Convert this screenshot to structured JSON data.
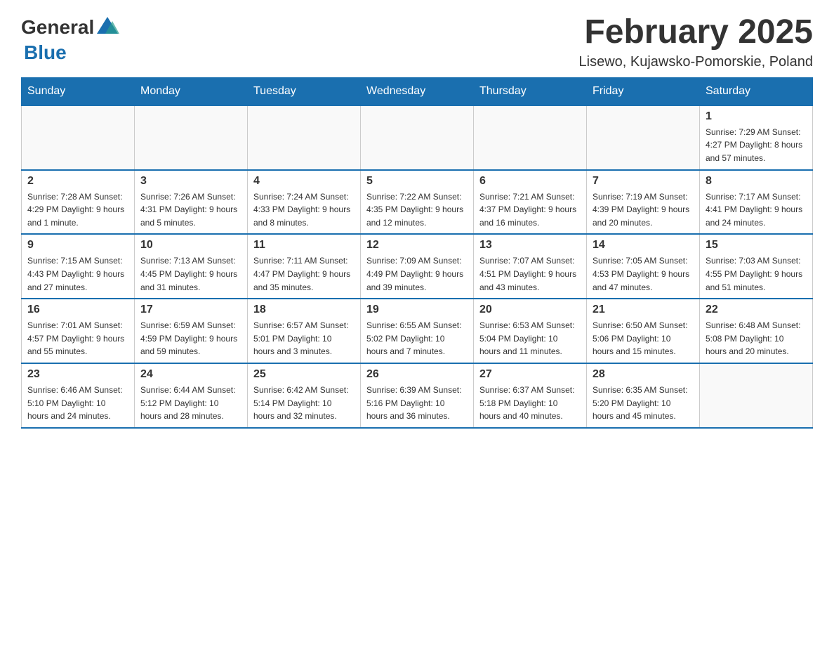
{
  "header": {
    "logo_general": "General",
    "logo_blue": "Blue",
    "title": "February 2025",
    "subtitle": "Lisewo, Kujawsko-Pomorskie, Poland"
  },
  "days_of_week": [
    "Sunday",
    "Monday",
    "Tuesday",
    "Wednesday",
    "Thursday",
    "Friday",
    "Saturday"
  ],
  "weeks": [
    [
      {
        "day": "",
        "info": ""
      },
      {
        "day": "",
        "info": ""
      },
      {
        "day": "",
        "info": ""
      },
      {
        "day": "",
        "info": ""
      },
      {
        "day": "",
        "info": ""
      },
      {
        "day": "",
        "info": ""
      },
      {
        "day": "1",
        "info": "Sunrise: 7:29 AM\nSunset: 4:27 PM\nDaylight: 8 hours\nand 57 minutes."
      }
    ],
    [
      {
        "day": "2",
        "info": "Sunrise: 7:28 AM\nSunset: 4:29 PM\nDaylight: 9 hours\nand 1 minute."
      },
      {
        "day": "3",
        "info": "Sunrise: 7:26 AM\nSunset: 4:31 PM\nDaylight: 9 hours\nand 5 minutes."
      },
      {
        "day": "4",
        "info": "Sunrise: 7:24 AM\nSunset: 4:33 PM\nDaylight: 9 hours\nand 8 minutes."
      },
      {
        "day": "5",
        "info": "Sunrise: 7:22 AM\nSunset: 4:35 PM\nDaylight: 9 hours\nand 12 minutes."
      },
      {
        "day": "6",
        "info": "Sunrise: 7:21 AM\nSunset: 4:37 PM\nDaylight: 9 hours\nand 16 minutes."
      },
      {
        "day": "7",
        "info": "Sunrise: 7:19 AM\nSunset: 4:39 PM\nDaylight: 9 hours\nand 20 minutes."
      },
      {
        "day": "8",
        "info": "Sunrise: 7:17 AM\nSunset: 4:41 PM\nDaylight: 9 hours\nand 24 minutes."
      }
    ],
    [
      {
        "day": "9",
        "info": "Sunrise: 7:15 AM\nSunset: 4:43 PM\nDaylight: 9 hours\nand 27 minutes."
      },
      {
        "day": "10",
        "info": "Sunrise: 7:13 AM\nSunset: 4:45 PM\nDaylight: 9 hours\nand 31 minutes."
      },
      {
        "day": "11",
        "info": "Sunrise: 7:11 AM\nSunset: 4:47 PM\nDaylight: 9 hours\nand 35 minutes."
      },
      {
        "day": "12",
        "info": "Sunrise: 7:09 AM\nSunset: 4:49 PM\nDaylight: 9 hours\nand 39 minutes."
      },
      {
        "day": "13",
        "info": "Sunrise: 7:07 AM\nSunset: 4:51 PM\nDaylight: 9 hours\nand 43 minutes."
      },
      {
        "day": "14",
        "info": "Sunrise: 7:05 AM\nSunset: 4:53 PM\nDaylight: 9 hours\nand 47 minutes."
      },
      {
        "day": "15",
        "info": "Sunrise: 7:03 AM\nSunset: 4:55 PM\nDaylight: 9 hours\nand 51 minutes."
      }
    ],
    [
      {
        "day": "16",
        "info": "Sunrise: 7:01 AM\nSunset: 4:57 PM\nDaylight: 9 hours\nand 55 minutes."
      },
      {
        "day": "17",
        "info": "Sunrise: 6:59 AM\nSunset: 4:59 PM\nDaylight: 9 hours\nand 59 minutes."
      },
      {
        "day": "18",
        "info": "Sunrise: 6:57 AM\nSunset: 5:01 PM\nDaylight: 10 hours\nand 3 minutes."
      },
      {
        "day": "19",
        "info": "Sunrise: 6:55 AM\nSunset: 5:02 PM\nDaylight: 10 hours\nand 7 minutes."
      },
      {
        "day": "20",
        "info": "Sunrise: 6:53 AM\nSunset: 5:04 PM\nDaylight: 10 hours\nand 11 minutes."
      },
      {
        "day": "21",
        "info": "Sunrise: 6:50 AM\nSunset: 5:06 PM\nDaylight: 10 hours\nand 15 minutes."
      },
      {
        "day": "22",
        "info": "Sunrise: 6:48 AM\nSunset: 5:08 PM\nDaylight: 10 hours\nand 20 minutes."
      }
    ],
    [
      {
        "day": "23",
        "info": "Sunrise: 6:46 AM\nSunset: 5:10 PM\nDaylight: 10 hours\nand 24 minutes."
      },
      {
        "day": "24",
        "info": "Sunrise: 6:44 AM\nSunset: 5:12 PM\nDaylight: 10 hours\nand 28 minutes."
      },
      {
        "day": "25",
        "info": "Sunrise: 6:42 AM\nSunset: 5:14 PM\nDaylight: 10 hours\nand 32 minutes."
      },
      {
        "day": "26",
        "info": "Sunrise: 6:39 AM\nSunset: 5:16 PM\nDaylight: 10 hours\nand 36 minutes."
      },
      {
        "day": "27",
        "info": "Sunrise: 6:37 AM\nSunset: 5:18 PM\nDaylight: 10 hours\nand 40 minutes."
      },
      {
        "day": "28",
        "info": "Sunrise: 6:35 AM\nSunset: 5:20 PM\nDaylight: 10 hours\nand 45 minutes."
      },
      {
        "day": "",
        "info": ""
      }
    ]
  ]
}
